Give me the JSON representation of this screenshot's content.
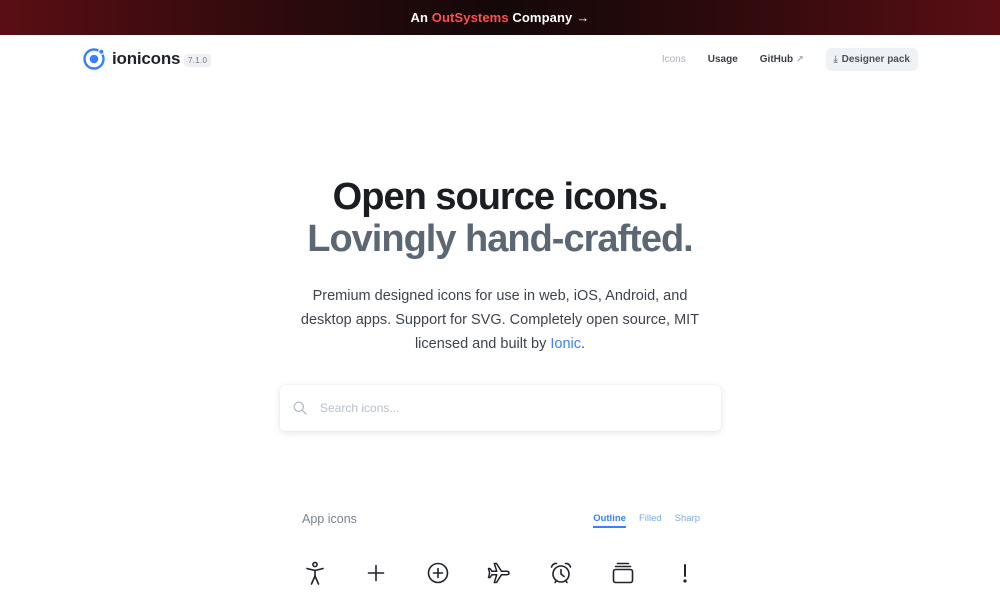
{
  "banner": {
    "prefix": "An ",
    "brand": "OutSystems",
    "suffix": " Company",
    "arrow": "→"
  },
  "navbar": {
    "brand_name": "ionicons",
    "version": "7.1.0",
    "links": {
      "icons": "Icons",
      "usage": "Usage",
      "github": "GitHub"
    },
    "designer_pack": "Designer pack"
  },
  "hero": {
    "title_line1": "Open source icons.",
    "title_line2": "Lovingly hand-crafted.",
    "desc_main": "Premium designed icons for use in web, iOS, Android, and desktop apps. Support for SVG. Completely open source, MIT licensed and built by ",
    "desc_link": "Ionic",
    "desc_end": "."
  },
  "search": {
    "placeholder": "Search icons..."
  },
  "app_icons": {
    "title": "App icons",
    "tabs": {
      "outline": "Outline",
      "filled": "Filled",
      "sharp": "Sharp"
    },
    "active_tab": "outline",
    "icons": [
      "accessibility-icon",
      "add-icon",
      "add-circle-icon",
      "airplane-icon",
      "alarm-icon",
      "albums-icon",
      "alert-icon"
    ]
  },
  "colors": {
    "accent": "#3880ff",
    "banner_brand": "#ff4f4f",
    "heading": "#1a1d21",
    "subheading": "#5c6774"
  }
}
